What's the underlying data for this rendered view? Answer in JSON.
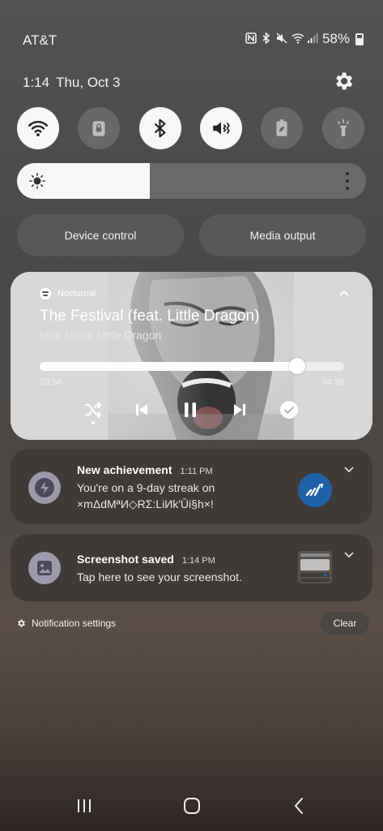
{
  "status_bar": {
    "carrier": "AT&T",
    "battery_text": "58%",
    "battery_level": 0.58,
    "icons": [
      "nfc-icon",
      "bluetooth-icon",
      "mute-icon",
      "wifi-icon",
      "signal-icon",
      "battery-icon"
    ]
  },
  "header": {
    "time": "1:14",
    "date": "Thu, Oct 3",
    "settings_icon": "gear-icon"
  },
  "quick_toggles": [
    {
      "name": "wifi",
      "icon": "wifi-icon",
      "state": "on"
    },
    {
      "name": "lock-rotation",
      "icon": "lock-rotation-icon",
      "state": "off"
    },
    {
      "name": "bluetooth",
      "icon": "bluetooth-icon",
      "state": "on"
    },
    {
      "name": "sound",
      "icon": "mute-icon",
      "state": "on"
    },
    {
      "name": "power-saving",
      "icon": "power-saving-icon",
      "state": "off"
    },
    {
      "name": "flashlight",
      "icon": "flashlight-icon",
      "state": "off"
    }
  ],
  "brightness": {
    "level": 0.38
  },
  "buttons": {
    "device_control": "Device control",
    "media_output": "Media output"
  },
  "media": {
    "app": "Nocturnal",
    "title": "The Festival (feat. Little Dragon)",
    "artist": "Mac Miller, Little Dragon",
    "elapsed": "03:56",
    "duration": "04:39",
    "progress": 0.846
  },
  "notifications": [
    {
      "title": "New achievement",
      "time": "1:11 PM",
      "line1": "You're on a 9-day streak on",
      "line2": "×mΔdMªИ◇RΣ:LiИk'Ūi§h×!"
    },
    {
      "title": "Screenshot saved",
      "time": "1:14 PM",
      "line1": "Tap here to see your screenshot."
    }
  ],
  "footer": {
    "notification_settings": "Notification settings",
    "clear": "Clear"
  },
  "colors": {
    "accent_blue": "#1f62a8",
    "toggle_on": "#f7f7f7",
    "toggle_off": "#6a6866"
  }
}
